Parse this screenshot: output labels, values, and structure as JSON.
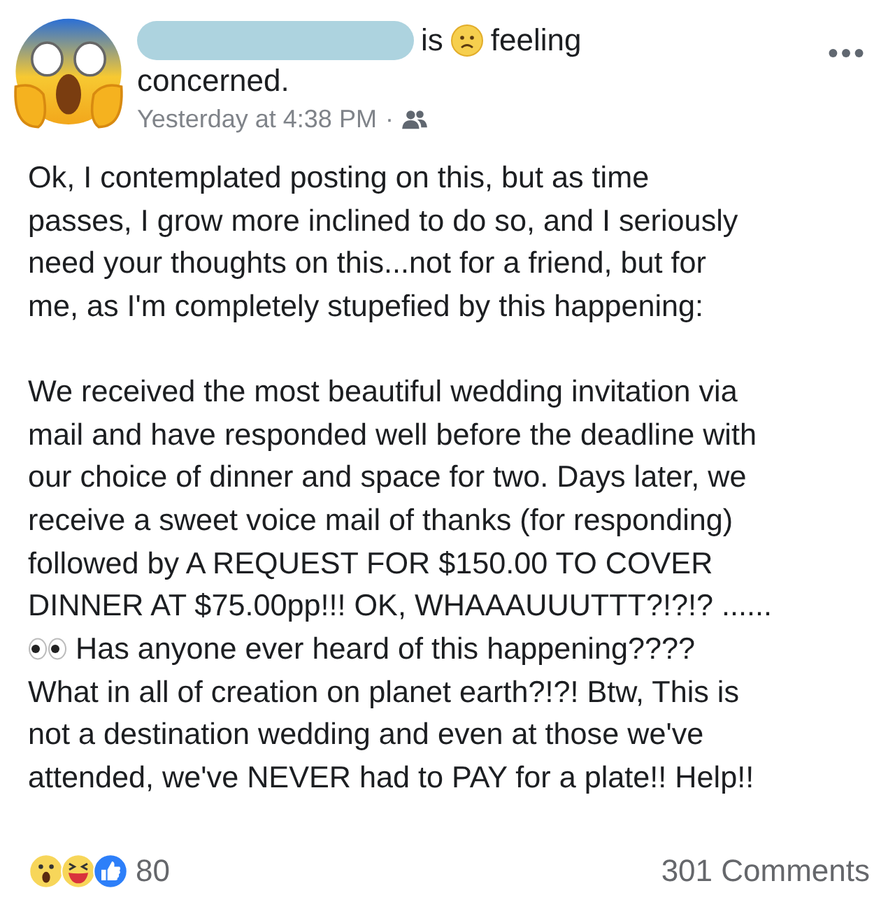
{
  "post": {
    "header_is": "is",
    "feeling": "feeling",
    "feeling_text": "concerned.",
    "timestamp": "Yesterday at 4:38 PM",
    "separator": "·",
    "paragraphs": [
      {
        "kind": "plain",
        "lines": [
          "Ok, I contemplated posting on this, but as time",
          "passes, I grow more inclined to do so, and I seriously",
          "need your thoughts on this...not for a friend, but for",
          "me, as I'm completely stupefied by this happening:"
        ]
      },
      {
        "kind": "plain",
        "lines": [
          "We received the most beautiful wedding invitation via",
          "mail and have responded well before the deadline with",
          "our choice of dinner and space for two. Days later, we",
          "receive a sweet voice mail of thanks (for responding)",
          "followed by A REQUEST FOR $150.00 TO COVER",
          "DINNER AT $75.00pp!!! OK, WHAAAUUUTTT?!?!? ......"
        ]
      },
      {
        "kind": "eyes",
        "lines": [
          "Has anyone ever heard of this happening????",
          "What in all of creation on planet earth?!?! Btw, This is",
          "not a destination wedding and even at those we've",
          "attended, we've NEVER had to PAY for a plate!! Help!!"
        ]
      }
    ],
    "reaction_count": "80",
    "comments": "301 Comments"
  }
}
